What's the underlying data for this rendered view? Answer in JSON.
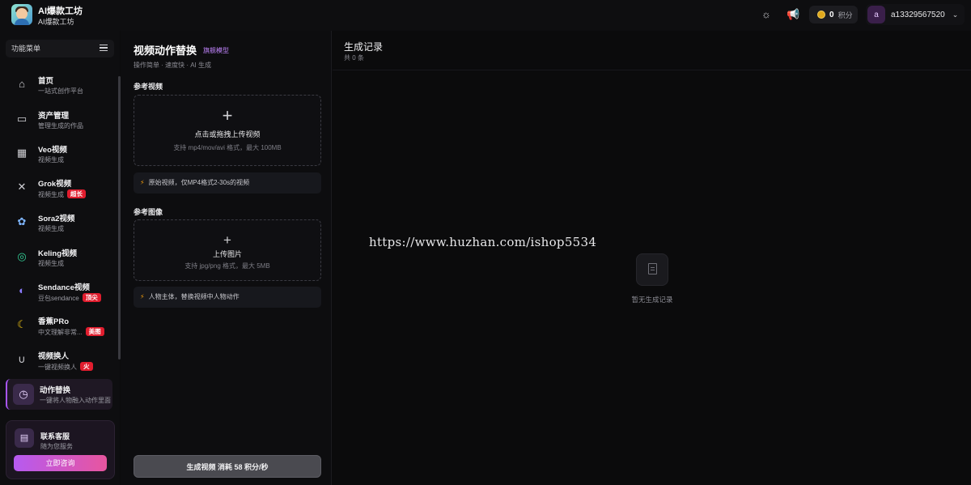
{
  "header": {
    "brand_title": "AI爆款工坊",
    "brand_subtitle": "AI爆款工坊",
    "theme_icon": "sun-icon",
    "announce_icon": "megaphone-icon",
    "points_value": "0",
    "points_unit": "积分",
    "avatar_letter": "a",
    "username": "a13329567520"
  },
  "sidebar": {
    "menu_title": "功能菜单",
    "items": [
      {
        "icon": "home-icon",
        "glyph": "⌂",
        "title": "首页",
        "sub": "一站式创作平台",
        "badge": ""
      },
      {
        "icon": "folder-icon",
        "glyph": "▭",
        "title": "资产管理",
        "sub": "管理生成的作品",
        "badge": ""
      },
      {
        "icon": "film-icon",
        "glyph": "▦",
        "title": "Veo视频",
        "sub": "视频生成",
        "badge": ""
      },
      {
        "icon": "grok-icon",
        "glyph": "✕",
        "title": "Grok视频",
        "sub": "视频生成",
        "badge": "超长"
      },
      {
        "icon": "sora-icon",
        "glyph": "✿",
        "title": "Sora2视频",
        "sub": "视频生成",
        "badge": ""
      },
      {
        "icon": "kling-icon",
        "glyph": "◎",
        "title": "Keling视频",
        "sub": "视频生成",
        "badge": ""
      },
      {
        "icon": "seedance-icon",
        "glyph": "◐",
        "title": "Sendance视频",
        "sub": "豆包sendance",
        "badge": "顶尖"
      },
      {
        "icon": "banana-icon",
        "glyph": "☾",
        "title": "香蕉PRo",
        "sub": "中文理解非常...",
        "badge": "美图"
      },
      {
        "icon": "magnet-icon",
        "glyph": "∪",
        "title": "视频换人",
        "sub": "一键视频换人",
        "badge": "火"
      },
      {
        "icon": "clock-icon",
        "glyph": "◷",
        "title": "动作替换",
        "sub": "一键将人物融入动作里面",
        "badge": ""
      }
    ],
    "support": {
      "icon": "chat-icon",
      "title": "联系客服",
      "subtitle": "随为您服务",
      "button": "立即咨询"
    }
  },
  "center": {
    "title": "视频动作替换",
    "tag": "旗舰模型",
    "crumb": "操作简单 · 速度快 · AI 生成",
    "video_label": "参考视频",
    "video_upload_main": "点击或拖拽上传视频",
    "video_upload_hint": "支持 mp4/mov/avi 格式，最大 100MB",
    "video_tip": "原始视频，仅MP4格式2-30s的视频",
    "image_label": "参考图像",
    "image_upload_main": "上传图片",
    "image_upload_hint": "支持 jpg/png 格式，最大 5MB",
    "image_tip": "人物主体，替换视频中人物动作",
    "generate_button": "生成视频 消耗 58 积分/秒"
  },
  "records": {
    "title": "生成记录",
    "count": "共 0 条",
    "watermark": "https://www.huzhan.com/ishop5534",
    "empty_text": "暂无生成记录"
  }
}
